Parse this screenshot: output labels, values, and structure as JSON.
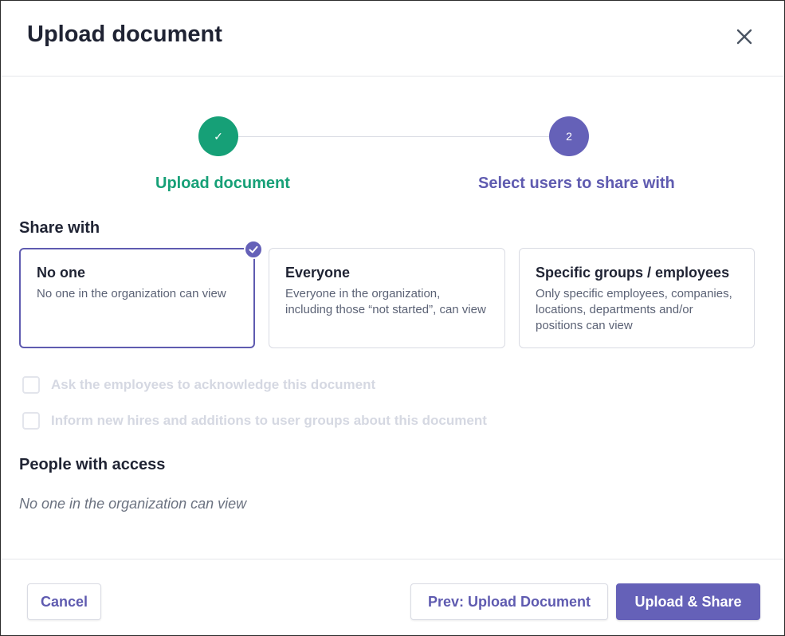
{
  "header": {
    "title": "Upload document"
  },
  "stepper": {
    "steps": [
      {
        "label": "Upload document",
        "badge": "✓",
        "state": "completed",
        "color": "#16a077"
      },
      {
        "label": "Select users to share with",
        "badge": "2",
        "state": "active",
        "color": "#6561b8"
      }
    ]
  },
  "share": {
    "title": "Share with",
    "selected": "No one",
    "options": [
      {
        "title": "No one",
        "description": "No one in the organization can view"
      },
      {
        "title": "Everyone",
        "description": "Everyone in the organization, including those “not started”, can view"
      },
      {
        "title": "Specific groups / employees",
        "description": "Only specific employees, companies, locations, departments and/or positions can view"
      }
    ]
  },
  "checkboxes": [
    {
      "label": "Ask the employees to acknowledge this document",
      "checked": false,
      "disabled": true
    },
    {
      "label": "Inform new hires and additions to user groups about this document",
      "checked": false,
      "disabled": true
    }
  ],
  "access": {
    "title": "People with access",
    "value": "No one in the organization can view"
  },
  "footer": {
    "cancel_label": "Cancel",
    "prev_label": "Prev: Upload Document",
    "share_label": "Upload & Share"
  },
  "icons": {
    "close": "close-icon",
    "check": "check-icon"
  },
  "colors": {
    "accent": "#6561b8",
    "success": "#16a077"
  }
}
